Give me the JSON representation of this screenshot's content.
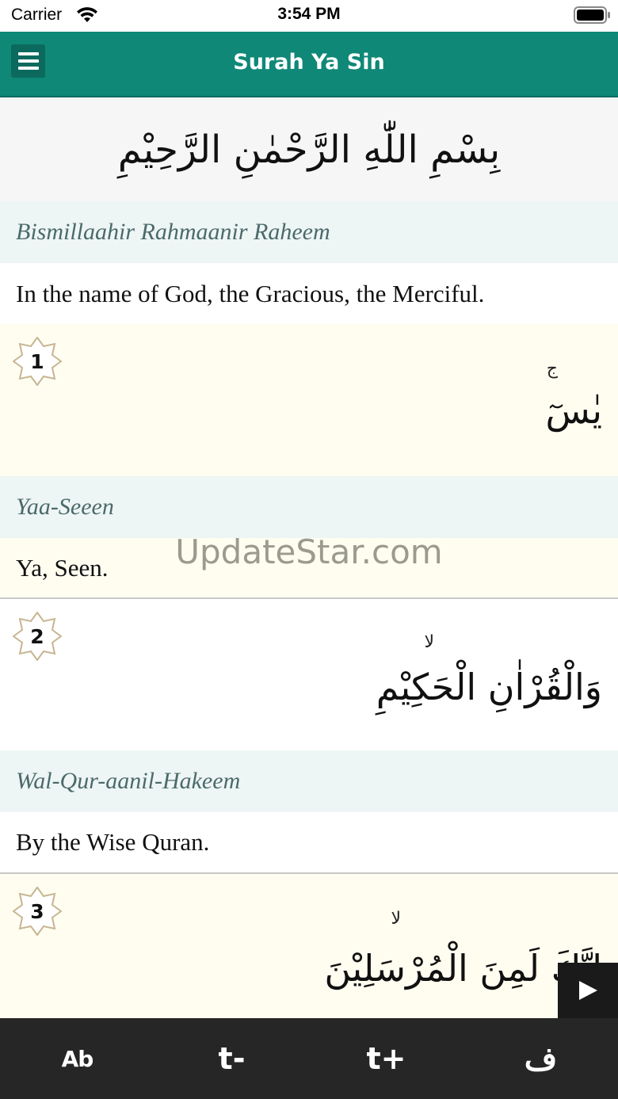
{
  "status_bar": {
    "carrier": "Carrier",
    "time": "3:54 PM"
  },
  "nav": {
    "title": "Surah Ya Sin"
  },
  "bismillah": {
    "arabic": "بِسْمِ اللّٰهِ الرَّحْمٰنِ الرَّحِيْمِ",
    "transliteration": "Bismillaahir Rahmaanir Raheem",
    "translation": "In the name of God, the Gracious, the Merciful."
  },
  "verses": [
    {
      "number": "1",
      "arabic": "يٰسٓ",
      "waqf": "ج",
      "transliteration": "Yaa-Seeen",
      "translation": "Ya, Seen."
    },
    {
      "number": "2",
      "arabic": "وَالْقُرْاٰنِ الْحَكِيْمِ",
      "waqf": "لا",
      "transliteration": "Wal-Qur-aanil-Hakeem",
      "translation": "By the Wise Quran."
    },
    {
      "number": "3",
      "arabic": "اِنَّكَ لَمِنَ الْمُرْسَلِيْنَ",
      "waqf": "لا"
    }
  ],
  "watermark": "UpdateStar.com",
  "toolbar": {
    "ab_label": "Ab",
    "font_decrease_label": "t-",
    "font_increase_label": "t+",
    "arabic_label": "ف"
  },
  "colors": {
    "nav_bg": "#0f8877",
    "translit_bg": "#eef5f5",
    "verse_odd_bg": "#fefdf0",
    "toolbar_bg": "#262626"
  }
}
